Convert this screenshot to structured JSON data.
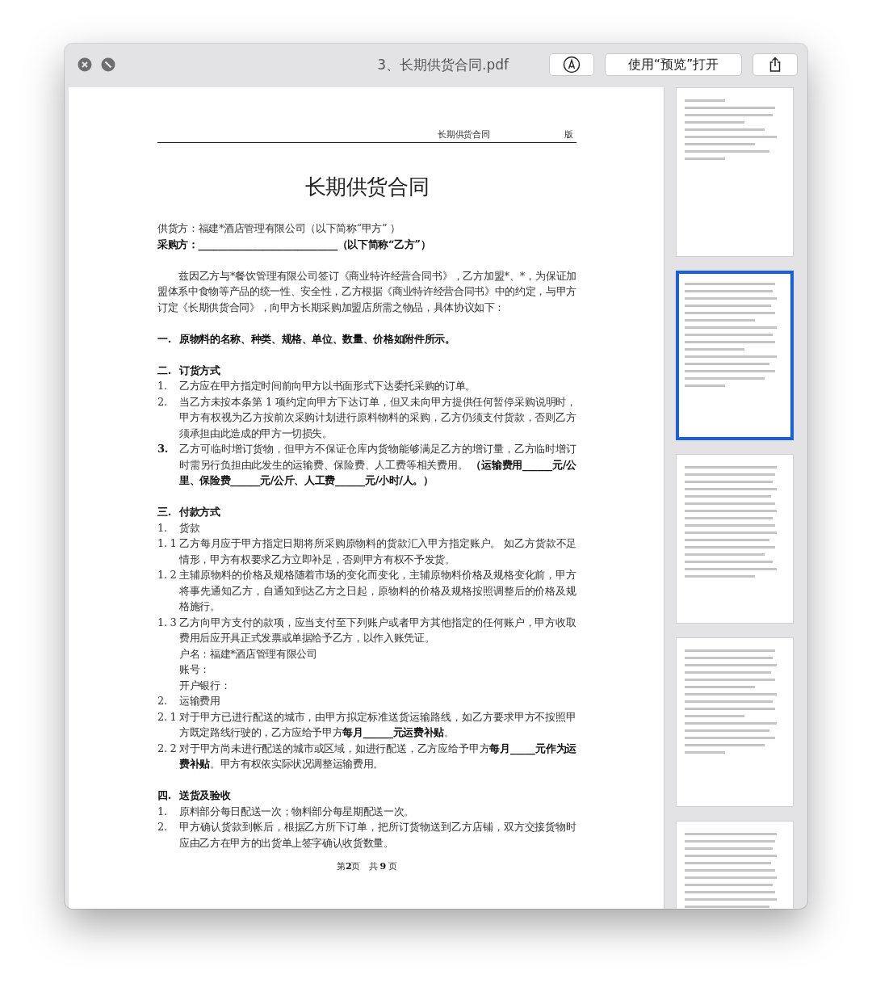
{
  "window": {
    "title": "3、长期供货合同.pdf",
    "buttons": [
      {
        "kind": "markup"
      },
      {
        "kind": "open",
        "label": "使用“预览”打开"
      },
      {
        "kind": "share"
      }
    ]
  },
  "document": {
    "header_title": "长期供货合同",
    "header_mark": "版",
    "title": "长期供货合同",
    "blocks": [
      {
        "kind": "line",
        "text": "供货方：福建*酒店管理有限公司（以下简称“甲方” ）"
      },
      {
        "kind": "line",
        "text": "**采购方：____________________________（以下简称“乙方”）**"
      },
      {
        "kind": "para",
        "text": "兹因乙方与*餐饮管理有限公司签订《商业特许经营合同书》，乙方加盟*、*，为保证加盟体系中食物等产品的统一性、安全性，乙方根据《商业特许经营合同书》中的约定，与甲方订定《长期供货合同》，向甲方长期采购加盟店所需之物品，具体协议如下："
      },
      {
        "kind": "heading",
        "num": "一.",
        "text": "原物料的名称、种类、规格、单位、数量、价格如附件所示。"
      },
      {
        "kind": "heading",
        "num": "二.",
        "text": "订货方式"
      },
      {
        "kind": "item",
        "num": "1.",
        "text": "乙方应在甲方指定时间前向甲方以书面形式下达委托采购的订单。"
      },
      {
        "kind": "item",
        "num": "2.",
        "text": "当乙方未按本条第 1 项约定向甲方下达订单，但又未向甲方提供任何暂停采购说明时，甲方有权视为乙方按前次采购计划进行原料物料的采购，乙方仍须支付货款，否则乙方须承担由此造成的甲方一切损失。"
      },
      {
        "kind": "item",
        "num": "**3.**",
        "text": "乙方可临时增订货物，但甲方不保证仓库内货物能够满足乙方的增订量，乙方临时增订时需另行负担由此发生的运输费、保险费、人工费等相关费用。 **（运输费用______元/公里、保险费______元/公斤、人工费______元/小时/人。）**"
      },
      {
        "kind": "heading",
        "num": "三.",
        "text": "付款方式"
      },
      {
        "kind": "item",
        "num": "1.",
        "text": "货款"
      },
      {
        "kind": "item",
        "num": "1. 1",
        "text": "乙方每月应于甲方指定日期将所采购原物料的货款汇入甲方指定账户。 如乙方货款不足情形，甲方有权要求乙方立即补足，否则甲方有权不予发货。"
      },
      {
        "kind": "item",
        "num": "1. 2",
        "text": "主辅原物料的价格及规格随着市场的变化而变化，主辅原物料价格及规格变化前，甲方将事先通知乙方，自通知到达乙方之日起，原物料的价格及规格按照调整后的价格及规格施行。"
      },
      {
        "kind": "item",
        "num": "1. 3",
        "text": "乙方向甲方支付的款项，应当支付至下列账户或者甲方其他指定的任何账户，甲方收取费用后应开具正式发票或单据给予乙方，以作入账凭证。"
      },
      {
        "kind": "sub",
        "text": "户名：福建*酒店管理有限公司"
      },
      {
        "kind": "sub",
        "text": "账号："
      },
      {
        "kind": "sub",
        "text": "开户银行："
      },
      {
        "kind": "item",
        "num": "2.",
        "text": "运输费用"
      },
      {
        "kind": "item",
        "num": "2. 1",
        "text": "对于甲方已进行配送的城市，由甲方拟定标准送货运输路线，如乙方要求甲方不按照甲方既定路线行驶的，乙方应给予甲方**每月______元运费补贴**。"
      },
      {
        "kind": "item",
        "num": "2. 2",
        "text": "对于甲方尚未进行配送的城市或区域，如进行配送，乙方应给予甲方**每月_____元作为运费补贴**。甲方有权依实际状况调整运输费用。"
      },
      {
        "kind": "heading",
        "num": "四.",
        "text": "送货及验收"
      },
      {
        "kind": "item",
        "num": "1.",
        "text": "原料部分每日配送一次；物料部分每星期配送一次。"
      },
      {
        "kind": "item",
        "num": "2.",
        "text": "甲方确认货款到帐后，根据乙方所下订单，把所订货物送到乙方店铺，双方交接货物时应由乙方在甲方的出货单上签字确认收货数量。"
      }
    ],
    "footer": "第**2**页　共 **9** 页"
  },
  "thumbnails": [
    {
      "selected": false
    },
    {
      "selected": true
    },
    {
      "selected": false
    },
    {
      "selected": false
    },
    {
      "selected": false
    }
  ]
}
